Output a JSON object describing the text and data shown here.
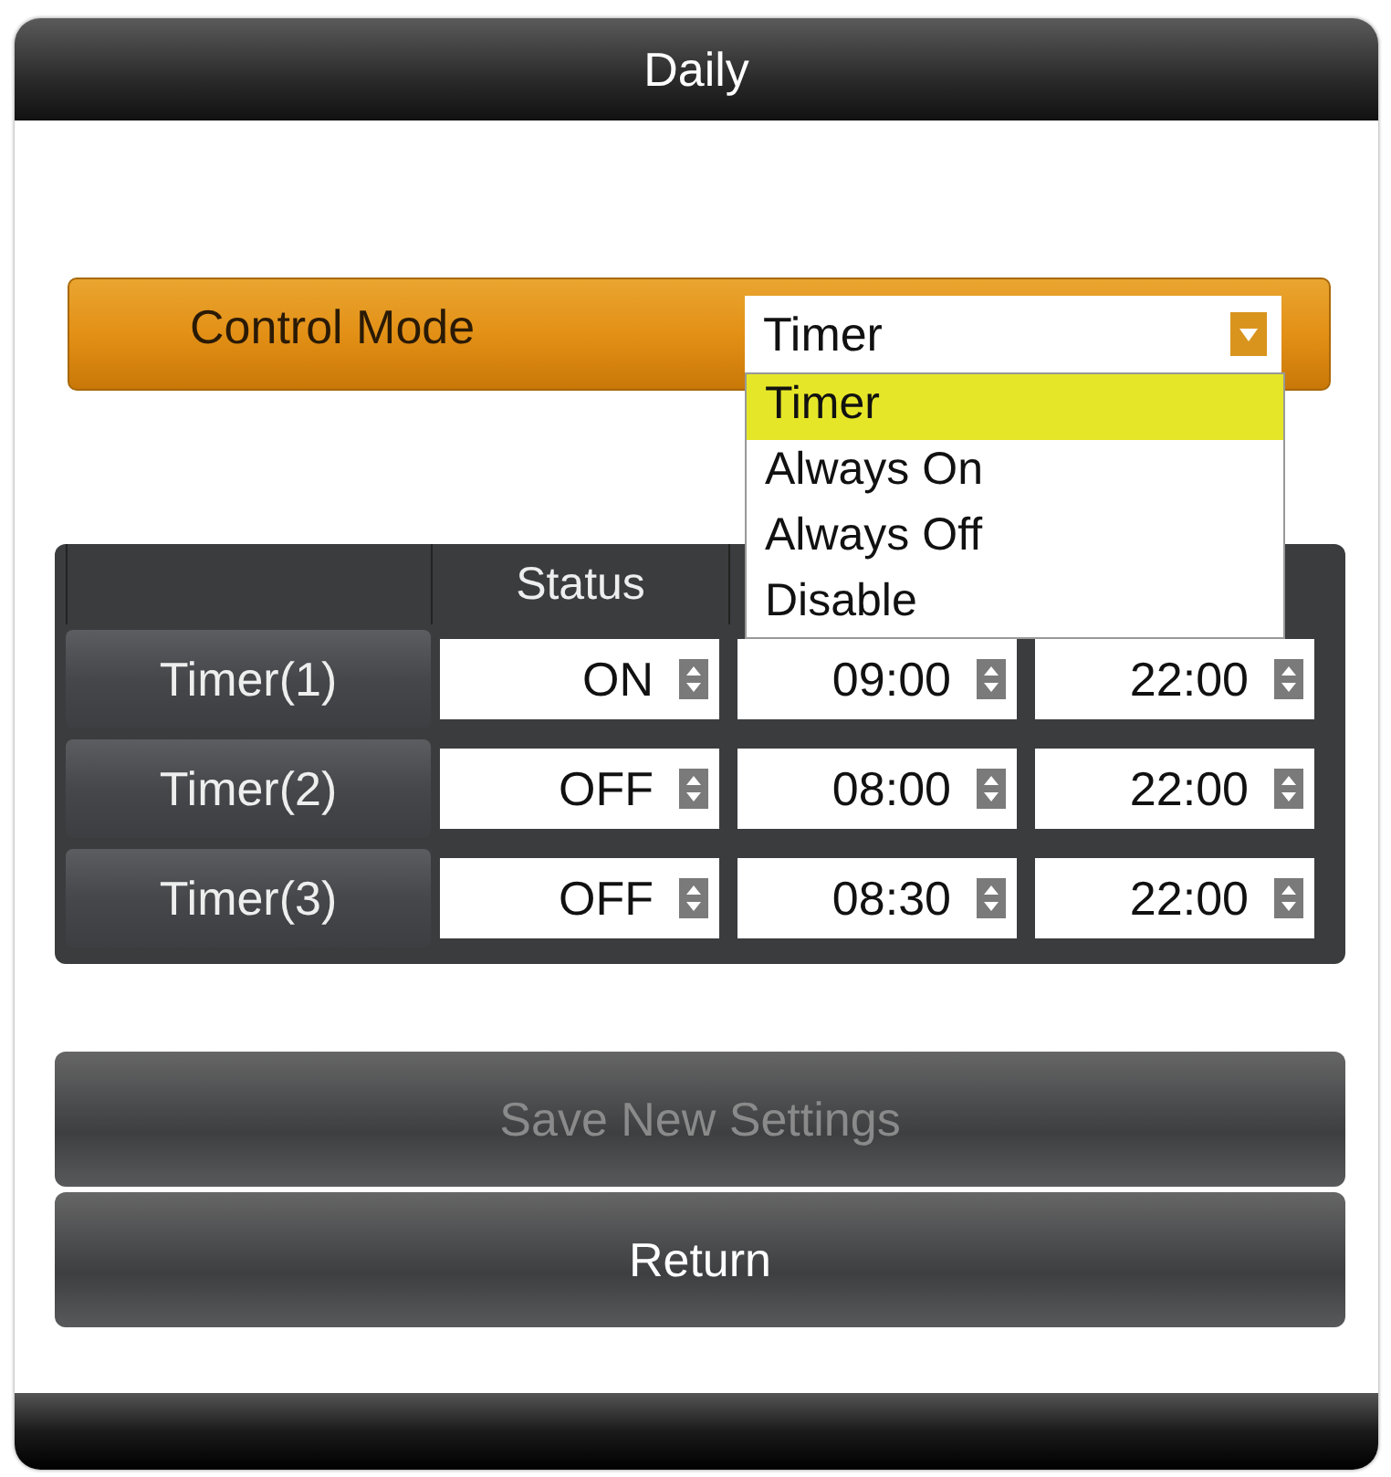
{
  "window": {
    "title": "Daily"
  },
  "control_mode": {
    "label": "Control Mode",
    "value": "Timer",
    "expanded": true,
    "options": [
      {
        "label": "Timer",
        "selected": true
      },
      {
        "label": "Always On",
        "selected": false
      },
      {
        "label": "Always Off",
        "selected": false
      },
      {
        "label": "Disable",
        "selected": false
      }
    ]
  },
  "table": {
    "columns": [
      "",
      "Status"
    ],
    "rows": [
      {
        "name": "Timer(1)",
        "status": "ON",
        "column_3": "09:00",
        "column_4": "22:00"
      },
      {
        "name": "Timer(2)",
        "status": "OFF",
        "column_3": "08:00",
        "column_4": "22:00"
      },
      {
        "name": "Timer(3)",
        "status": "OFF",
        "column_3": "08:30",
        "column_4": "22:00"
      }
    ]
  },
  "buttons": [
    {
      "label": "Save New Settings",
      "disabled": true
    },
    {
      "label": "Return",
      "disabled": false
    }
  ]
}
